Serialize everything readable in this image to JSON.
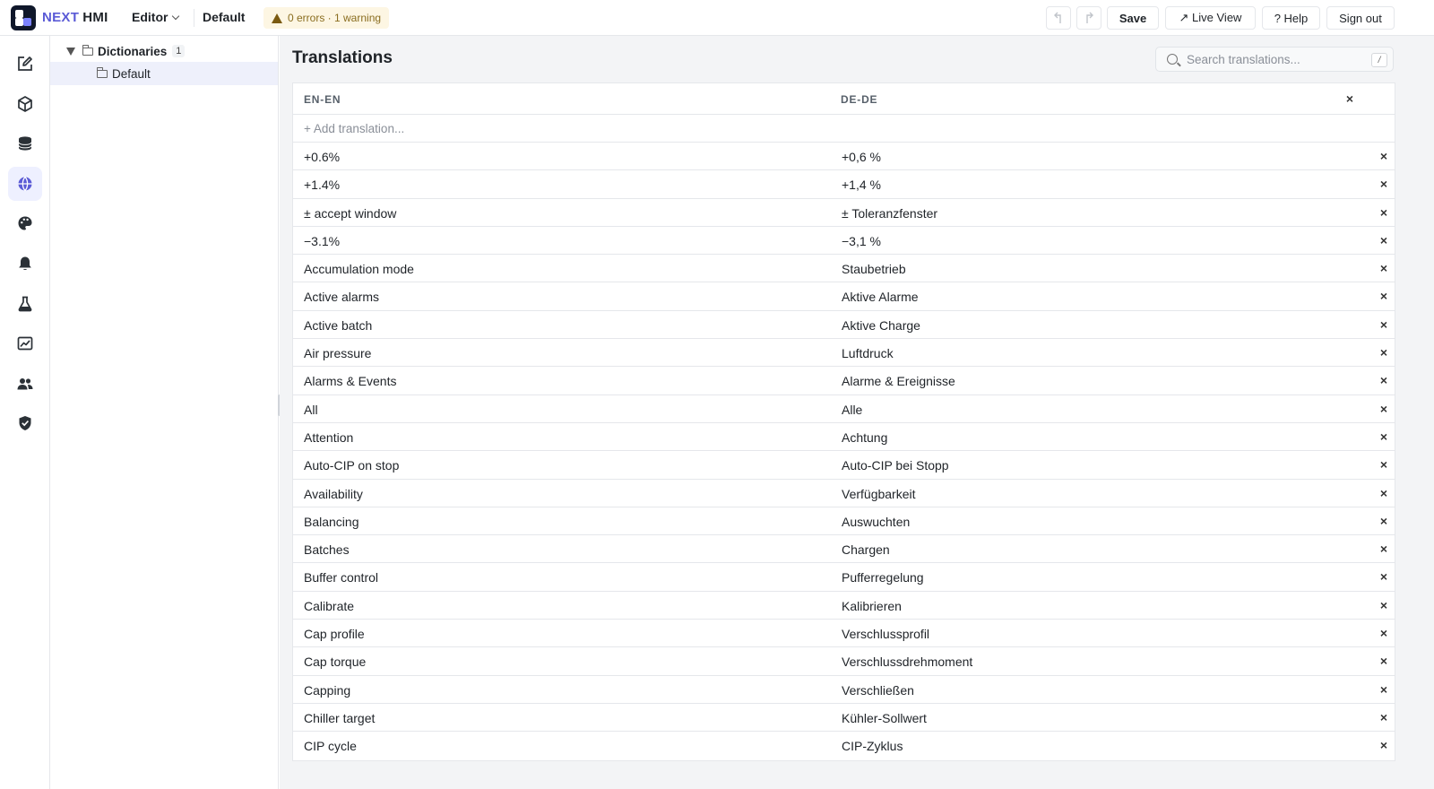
{
  "app": {
    "brand_next": "NEXT",
    "brand_hmi": "HMI"
  },
  "header": {
    "editor_menu": "Editor",
    "project": "Default",
    "status": "0 errors · 1 warning",
    "undo_icon": "undo-icon",
    "redo_icon": "redo-icon",
    "save": "Save",
    "live_view": "↗ Live View",
    "help": "? Help",
    "sign_out": "Sign out"
  },
  "rail": {
    "items": [
      {
        "name": "edit",
        "icon": "pencil-square-icon"
      },
      {
        "name": "components",
        "icon": "cube-icon"
      },
      {
        "name": "data",
        "icon": "database-icon"
      },
      {
        "name": "translations",
        "icon": "globe-icon",
        "active": true
      },
      {
        "name": "themes",
        "icon": "palette-icon"
      },
      {
        "name": "alarms",
        "icon": "bell-icon"
      },
      {
        "name": "recipes",
        "icon": "flask-icon"
      },
      {
        "name": "trends",
        "icon": "chart-icon"
      },
      {
        "name": "users",
        "icon": "users-icon"
      },
      {
        "name": "security",
        "icon": "shield-check-icon"
      }
    ]
  },
  "tree": {
    "root_label": "Dictionaries",
    "root_count": "1",
    "child_label": "Default"
  },
  "main": {
    "title": "Translations",
    "search_placeholder": "Search translations...",
    "search_shortcut": "/",
    "col_en": "EN-EN",
    "col_de": "DE-DE",
    "add_translation": "+ Add translation...",
    "remove_glyph": "×",
    "rows": [
      {
        "en": "+0.6%",
        "de": "+0,6 %"
      },
      {
        "en": "+1.4%",
        "de": "+1,4 %"
      },
      {
        "en": "± accept window",
        "de": "± Toleranzfenster"
      },
      {
        "en": "−3.1%",
        "de": "−3,1 %"
      },
      {
        "en": "Accumulation mode",
        "de": "Staubetrieb"
      },
      {
        "en": "Active alarms",
        "de": "Aktive Alarme"
      },
      {
        "en": "Active batch",
        "de": "Aktive Charge"
      },
      {
        "en": "Air pressure",
        "de": "Luftdruck"
      },
      {
        "en": "Alarms & Events",
        "de": "Alarme & Ereignisse"
      },
      {
        "en": "All",
        "de": "Alle"
      },
      {
        "en": "Attention",
        "de": "Achtung"
      },
      {
        "en": "Auto-CIP on stop",
        "de": "Auto-CIP bei Stopp"
      },
      {
        "en": "Availability",
        "de": "Verfügbarkeit"
      },
      {
        "en": "Balancing",
        "de": "Auswuchten"
      },
      {
        "en": "Batches",
        "de": "Chargen"
      },
      {
        "en": "Buffer control",
        "de": "Pufferregelung"
      },
      {
        "en": "Calibrate",
        "de": "Kalibrieren"
      },
      {
        "en": "Cap profile",
        "de": "Verschlussprofil"
      },
      {
        "en": "Cap torque",
        "de": "Verschlussdrehmoment"
      },
      {
        "en": "Capping",
        "de": "Verschließen"
      },
      {
        "en": "Chiller target",
        "de": "Kühler-Sollwert"
      },
      {
        "en": "CIP cycle",
        "de": "CIP-Zyklus"
      }
    ]
  },
  "colors": {
    "accent": "#5b5bd6",
    "active_bg": "#eef0ff",
    "warning_bg": "#fdf6e3",
    "warning_text": "#8a6d1f"
  }
}
